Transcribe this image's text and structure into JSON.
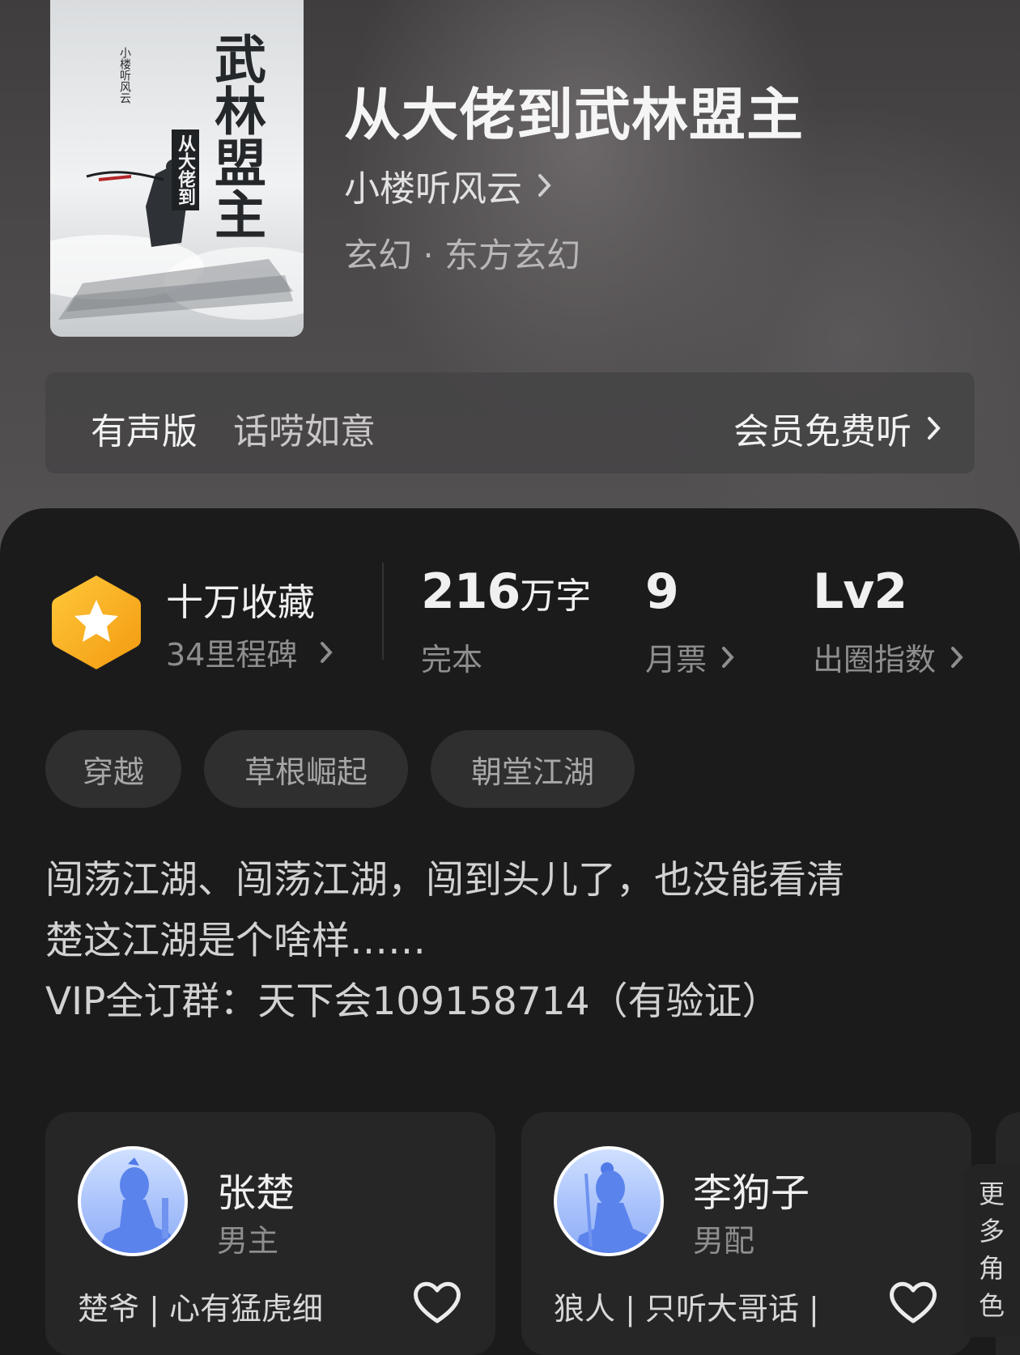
{
  "book": {
    "title": "从大佬到武林盟主",
    "author": "小楼听风云",
    "genre": "玄幻 · 东方玄幻",
    "cover": {
      "title_art": "武林盟主",
      "subtitle_art": "从大佬到",
      "author_art": "小楼听风云"
    }
  },
  "audio": {
    "label": "有声版",
    "narrator": "话唠如意",
    "action": "会员免费听"
  },
  "stats": {
    "collection": "十万收藏",
    "milestones": "34里程碑",
    "words_num": "216",
    "words_unit": "万字",
    "status": "完本",
    "monthly_votes": "9",
    "monthly_votes_label": "月票",
    "level": "Lv2",
    "level_label": "出圈指数"
  },
  "tags": [
    "穿越",
    "草根崛起",
    "朝堂江湖"
  ],
  "description": {
    "line1": "闯荡江湖、闯荡江湖，闯到头儿了，也没能看清",
    "line2": "楚这江湖是个啥样……",
    "line3": "VIP全订群：天下会109158714（有验证）"
  },
  "characters": [
    {
      "name": "张楚",
      "role": "男主",
      "desc": "楚爷 | 心有猛虎细"
    },
    {
      "name": "李狗子",
      "role": "男配",
      "desc": "狼人 | 只听大哥话 |"
    }
  ],
  "more_roles": [
    "更",
    "多",
    "角",
    "色"
  ],
  "colors": {
    "badge_orange": "#f7a51c",
    "panel_bg": "#1b1b1c",
    "avatar_blue": "#8eadf6"
  }
}
